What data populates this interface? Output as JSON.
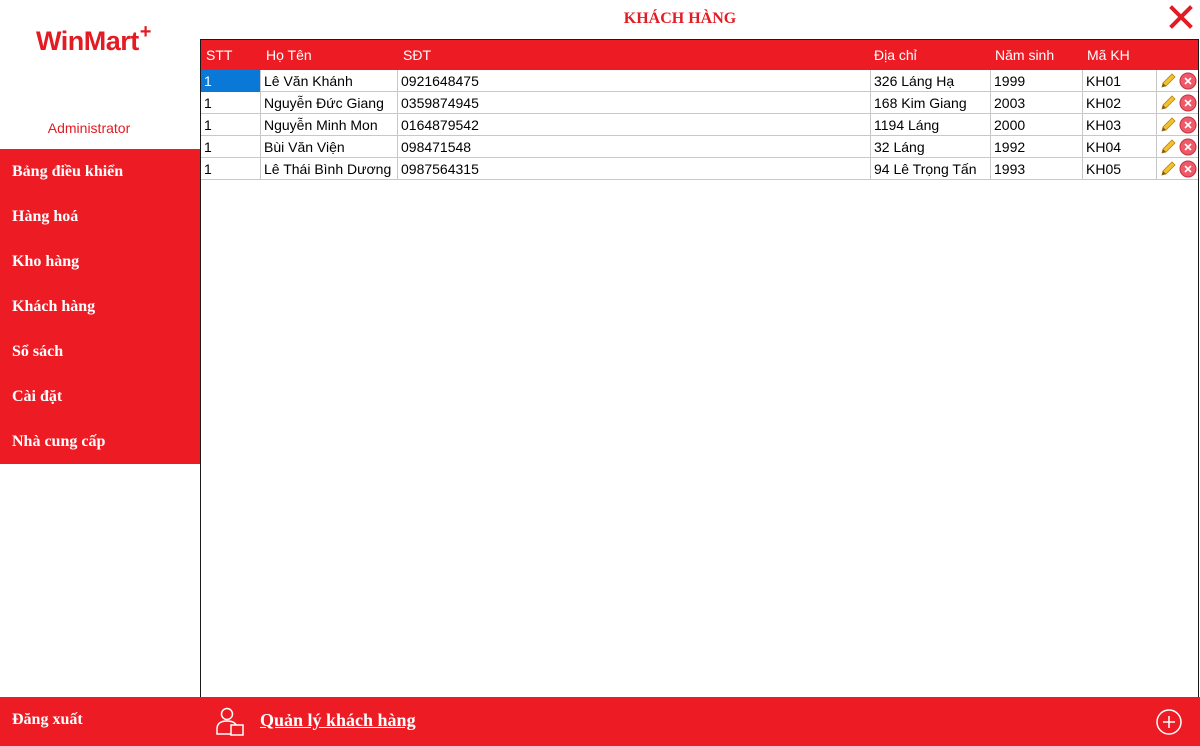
{
  "app": {
    "logo": "WinMart",
    "logo_plus": "+",
    "user": "Administrator"
  },
  "sidebar": {
    "items": [
      {
        "label": "Bảng điều khiển"
      },
      {
        "label": "Hàng hoá"
      },
      {
        "label": "Kho hàng"
      },
      {
        "label": "Khách hàng"
      },
      {
        "label": "Sổ sách"
      },
      {
        "label": "Cài đặt"
      },
      {
        "label": "Nhà cung cấp"
      }
    ],
    "logout": "Đăng xuất"
  },
  "header": {
    "title": "KHÁCH HÀNG"
  },
  "table": {
    "columns": [
      "STT",
      "Họ Tên",
      "SĐT",
      "Địa chỉ",
      "Năm sinh",
      "Mã KH"
    ],
    "rows": [
      {
        "stt": "1",
        "name": "Lê Văn Khánh",
        "phone": "0921648475",
        "address": "326 Láng Hạ",
        "year": "1999",
        "code": "KH01"
      },
      {
        "stt": "1",
        "name": "Nguyễn Đức Giang",
        "phone": "0359874945",
        "address": "168 Kim Giang",
        "year": "2003",
        "code": "KH02"
      },
      {
        "stt": "1",
        "name": "Nguyễn Minh Mon",
        "phone": "0164879542",
        "address": "1194 Láng",
        "year": "2000",
        "code": "KH03"
      },
      {
        "stt": "1",
        "name": "Bùi Văn Viện",
        "phone": "098471548",
        "address": "32 Láng",
        "year": "1992",
        "code": "KH04"
      },
      {
        "stt": "1",
        "name": "Lê Thái Bình Dương",
        "phone": "0987564315",
        "address": "94 Lê Trọng Tấn",
        "year": "1993",
        "code": "KH05"
      }
    ]
  },
  "footer": {
    "title": "Quản lý khách hàng"
  },
  "colors": {
    "brand_red": "#ed1c24",
    "selection_blue": "#0a78d7"
  },
  "icons": {
    "close": "close-icon",
    "edit": "pencil-icon",
    "delete": "delete-circle-icon",
    "footer": "customer-management-icon",
    "add": "add-circle-icon"
  }
}
